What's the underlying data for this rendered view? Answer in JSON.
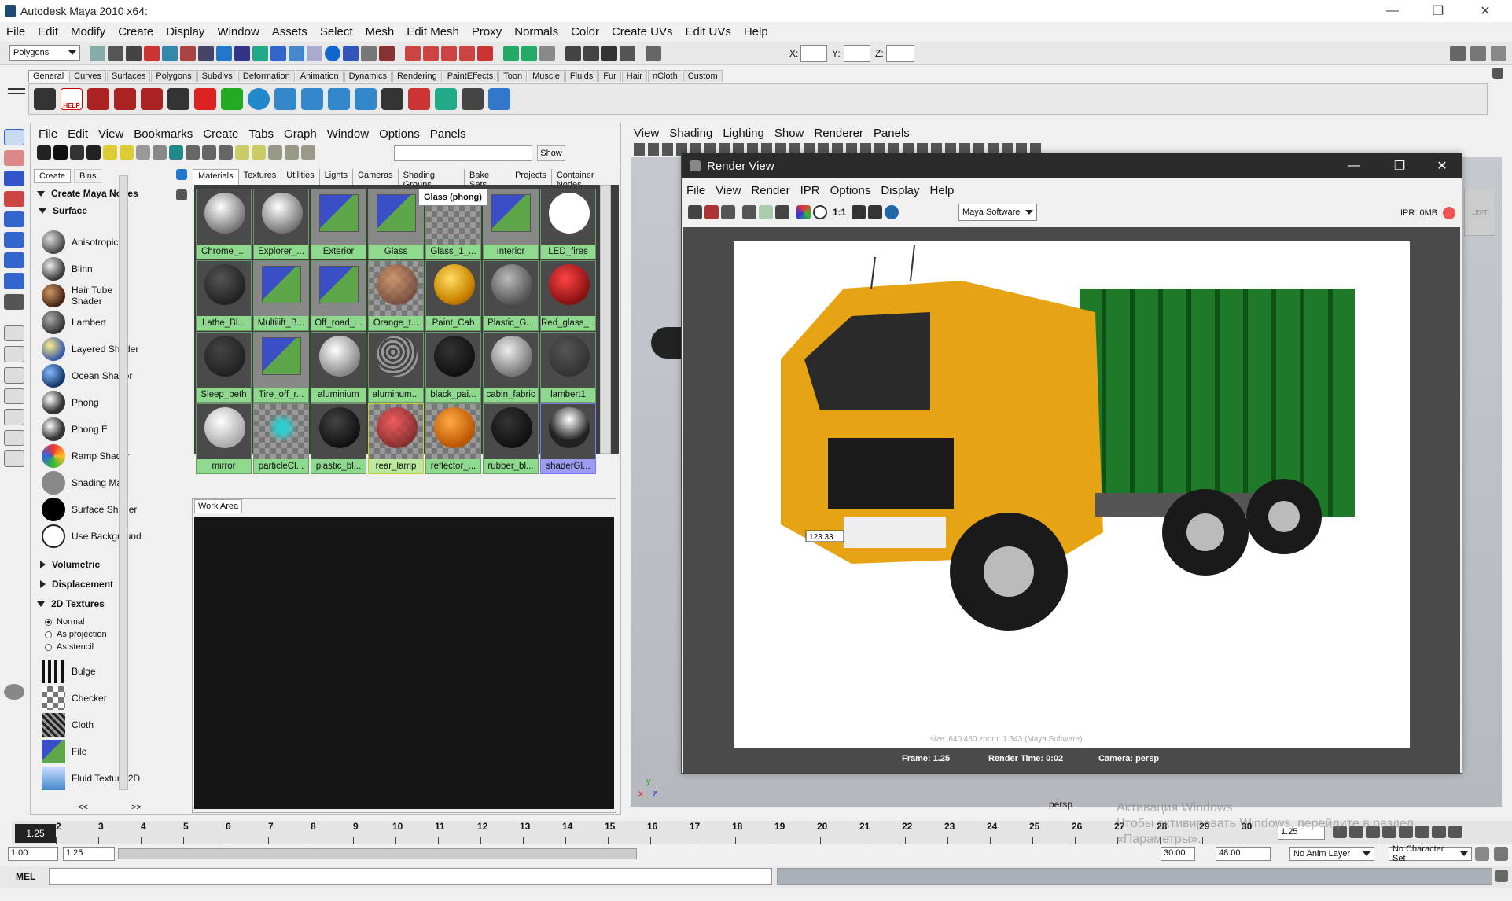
{
  "window": {
    "title": "Autodesk Maya 2010 x64:",
    "minimize": "—",
    "restore": "❐",
    "close": "✕"
  },
  "menu": [
    "File",
    "Edit",
    "Modify",
    "Create",
    "Display",
    "Window",
    "Assets",
    "Select",
    "Mesh",
    "Edit Mesh",
    "Proxy",
    "Normals",
    "Color",
    "Create UVs",
    "Edit UVs",
    "Help"
  ],
  "status_line": {
    "mode": "Polygons",
    "x_label": "X:",
    "y_label": "Y:",
    "z_label": "Z:"
  },
  "shelf_tabs": [
    "General",
    "Curves",
    "Surfaces",
    "Polygons",
    "Subdivs",
    "Deformation",
    "Animation",
    "Dynamics",
    "Rendering",
    "PaintEffects",
    "Toon",
    "Muscle",
    "Fluids",
    "Fur",
    "Hair",
    "nCloth",
    "Custom"
  ],
  "shelf_help": "HELP",
  "hypershade": {
    "menu": [
      "File",
      "Edit",
      "View",
      "Bookmarks",
      "Create",
      "Tabs",
      "Graph",
      "Window",
      "Options",
      "Panels"
    ],
    "show_button": "Show",
    "left_tabs": [
      "Create",
      "Bins"
    ],
    "create_header": "Create Maya Nodes",
    "surface_section": "Surface",
    "surface_nodes": [
      "Anisotropic",
      "Blinn",
      "Hair Tube Shader",
      "Lambert",
      "Layered Shader",
      "Ocean Shader",
      "Phong",
      "Phong E",
      "Ramp Shader",
      "Shading Map",
      "Surface Shader",
      "Use Background"
    ],
    "volumetric": "Volumetric",
    "displacement": "Displacement",
    "textures_section": "2D Textures",
    "radios": [
      "Normal",
      "As projection",
      "As stencil"
    ],
    "textures": [
      "Bulge",
      "Checker",
      "Cloth",
      "File",
      "Fluid Texture 2D"
    ],
    "scroll_left": "<<",
    "scroll_right": ">>",
    "tabs": [
      "Materials",
      "Textures",
      "Utilities",
      "Lights",
      "Cameras",
      "Shading Groups",
      "Bake Sets",
      "Projects",
      "Container Nodes"
    ],
    "tooltip": "Glass (phong)",
    "swatches": [
      "Chrome_...",
      "Explorer_...",
      "Exterior",
      "Glass",
      "Glass_1_...",
      "Interior",
      "LED_fires",
      "Lathe_Bl...",
      "Multilift_B...",
      "Off_road_...",
      "Orange_t...",
      "Paint_Cab",
      "Plastic_G...",
      "Red_glass_...",
      "Sleep_beth",
      "Tire_off_r...",
      "aluminium",
      "aluminum...",
      "black_pai...",
      "cabin_fabric",
      "lambert1",
      "mirror",
      "particleCl...",
      "plastic_bl...",
      "rear_lamp",
      "reflector_...",
      "rubber_bl...",
      "shaderGl..."
    ],
    "work_area": "Work Area"
  },
  "viewport": {
    "menu": [
      "View",
      "Shading",
      "Lighting",
      "Show",
      "Renderer",
      "Panels"
    ],
    "camera": "persp",
    "axis_x": "x",
    "axis_z": "z",
    "axis_y": "y"
  },
  "render_view": {
    "title": "Render View",
    "menu": [
      "File",
      "View",
      "Render",
      "IPR",
      "Options",
      "Display",
      "Help"
    ],
    "ratio": "1:1",
    "renderer": "Maya Software",
    "ipr_label": "IPR: 0MB",
    "info_line": "size: 640 480 zoom: 1.343 (Maya Software)",
    "frame": "Frame: 1.25",
    "render_time": "Render Time: 0:02",
    "camera": "Camera: persp",
    "plate": "123 33"
  },
  "timeline": {
    "current": "1.25",
    "ticks": [
      "2",
      "3",
      "4",
      "5",
      "6",
      "7",
      "8",
      "9",
      "10",
      "11",
      "12",
      "13",
      "14",
      "15",
      "16",
      "17",
      "18",
      "19",
      "20",
      "21",
      "22",
      "23",
      "24",
      "25",
      "26",
      "27",
      "28",
      "29",
      "30"
    ],
    "current_field": "1.25"
  },
  "range": {
    "start": "1.00",
    "start2": "1.25",
    "end1": "30.00",
    "end2": "48.00",
    "anim_layer": "No Anim Layer",
    "character_set": "No Character Set"
  },
  "watermark": {
    "line1": "Активация Windows",
    "line2": "Чтобы активировать Windows, перейдите в раздел",
    "line3": "«Параметры»."
  },
  "mel": {
    "label": "MEL"
  }
}
